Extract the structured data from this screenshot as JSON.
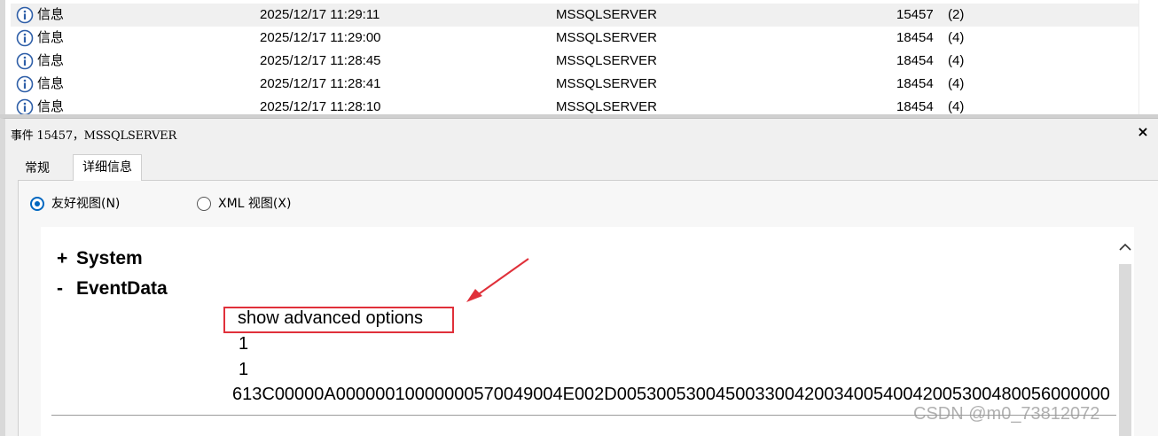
{
  "event_list": {
    "rows": [
      {
        "level": "信息",
        "datetime": "2025/12/17 11:29:11",
        "source": "MSSQLSERVER",
        "event_id": "15457",
        "category": "(2)",
        "selected": true
      },
      {
        "level": "信息",
        "datetime": "2025/12/17 11:29:00",
        "source": "MSSQLSERVER",
        "event_id": "18454",
        "category": "(4)",
        "selected": false
      },
      {
        "level": "信息",
        "datetime": "2025/12/17 11:28:45",
        "source": "MSSQLSERVER",
        "event_id": "18454",
        "category": "(4)",
        "selected": false
      },
      {
        "level": "信息",
        "datetime": "2025/12/17 11:28:41",
        "source": "MSSQLSERVER",
        "event_id": "18454",
        "category": "(4)",
        "selected": false
      },
      {
        "level": "信息",
        "datetime": "2025/12/17 11:28:10",
        "source": "MSSQLSERVER",
        "event_id": "18454",
        "category": "(4)",
        "selected": false
      }
    ],
    "row_icon": "info-icon"
  },
  "detail": {
    "title": "事件 15457，MSSQLSERVER",
    "close_label": "×",
    "tabs": [
      {
        "label": "常规",
        "active": false
      },
      {
        "label": "详细信息",
        "active": true
      }
    ],
    "view_options": [
      {
        "label": "友好视图(N)",
        "checked": true
      },
      {
        "label": "XML 视图(X)",
        "checked": false
      }
    ],
    "tree": {
      "system": {
        "sign": "+",
        "label": "System"
      },
      "eventdata": {
        "sign": "-",
        "label": "EventData"
      },
      "values": [
        "show advanced options",
        "1",
        "1",
        "613C00000A0000001000000057004900 4E002D00530053004500330042003400540042005300480056000000"
      ]
    },
    "scroll_up_icon": "chevron-up-icon"
  },
  "annotation": {
    "arrow_color": "#e0303a",
    "box_color": "#e0303a"
  },
  "watermark": "CSDN @m0_73812072",
  "colors": {
    "radio_accent": "#0067c0",
    "selected_row": "#f0f0f0"
  }
}
